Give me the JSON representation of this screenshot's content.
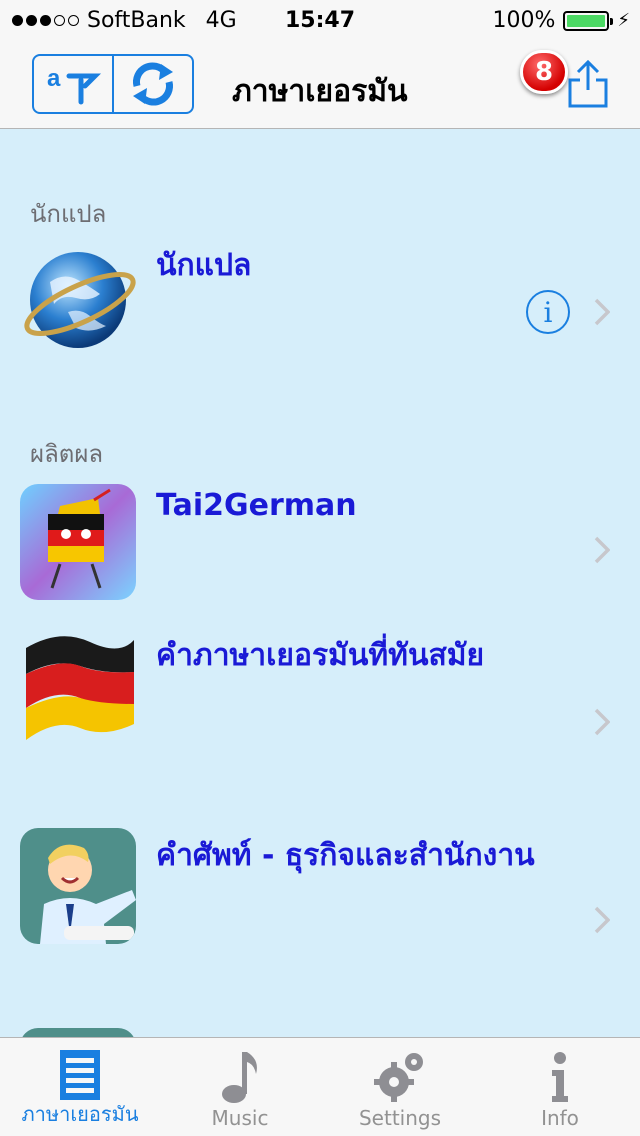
{
  "status_bar": {
    "carrier": "SoftBank",
    "network": "4G",
    "time": "15:47",
    "battery": "100%",
    "signal_bars": 3,
    "signal_total": 5
  },
  "navbar": {
    "title": "ภาษาเยอรมัน",
    "badge_count": "8"
  },
  "sections": [
    {
      "header": "นักแปล",
      "rows": [
        {
          "title": "นักแปล",
          "icon": "globe-icon",
          "has_info": true
        }
      ]
    },
    {
      "header": "ผลิตผล",
      "rows": [
        {
          "title": "Tai2German",
          "icon": "app-mascot-icon"
        },
        {
          "title": "คำภาษาเยอรมันที่ทันสมัย",
          "icon": "german-flag-icon"
        },
        {
          "title": "คำศัพท์ - ธุรกิจและสำนักงาน",
          "icon": "businessman-icon"
        }
      ]
    }
  ],
  "tabbar": {
    "tabs": [
      {
        "label": "ภาษาเยอรมัน",
        "icon": "list-icon",
        "active": true
      },
      {
        "label": "Music",
        "icon": "music-note-icon",
        "active": false
      },
      {
        "label": "Settings",
        "icon": "gears-icon",
        "active": false
      },
      {
        "label": "Info",
        "icon": "info-icon",
        "active": false
      }
    ]
  },
  "colors": {
    "accent": "#1a7fe0",
    "row_title": "#1a1ad6",
    "content_bg": "#d6eefa",
    "badge": "#d40000"
  }
}
